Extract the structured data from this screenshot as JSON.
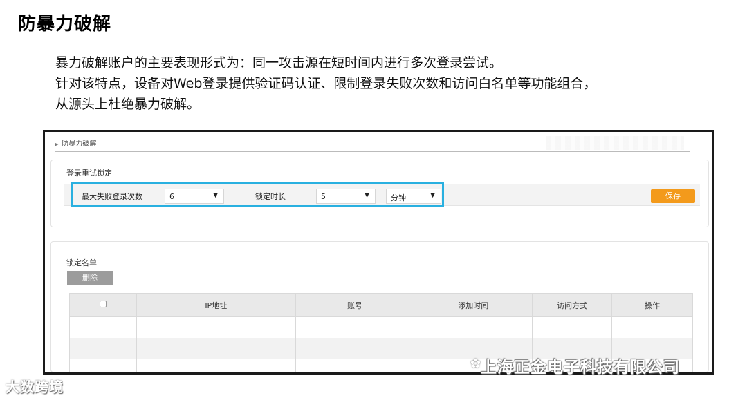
{
  "slide": {
    "title": "防暴力破解",
    "lines": [
      "暴力破解账户的主要表现形式为：同一攻击源在短时间内进行多次登录尝试。",
      "针对该特点，设备对Web登录提供验证码认证、限制登录失败次数和访问白名单等功能组合，",
      "从源头上杜绝暴力破解。"
    ]
  },
  "ui": {
    "breadcrumb": "防暴力破解",
    "retry_panel": {
      "title": "登录重试锁定",
      "max_fail_label": "最大失败登录次数",
      "max_fail_value": "6",
      "lock_duration_label": "锁定时长",
      "lock_duration_value": "5",
      "lock_unit_value": "分钟",
      "save_label": "保存"
    },
    "lock_list": {
      "title": "锁定名单",
      "delete_label": "删除",
      "columns": [
        "IP地址",
        "账号",
        "添加时间",
        "访问方式",
        "操作"
      ]
    }
  },
  "overlay": {
    "brand": "上海正金电子科技有限公司",
    "source": "大数跨境"
  },
  "colors": {
    "accent_save": "#f39a1b",
    "highlight_border": "#29b0e0",
    "delete_button": "#9c9c9c"
  }
}
